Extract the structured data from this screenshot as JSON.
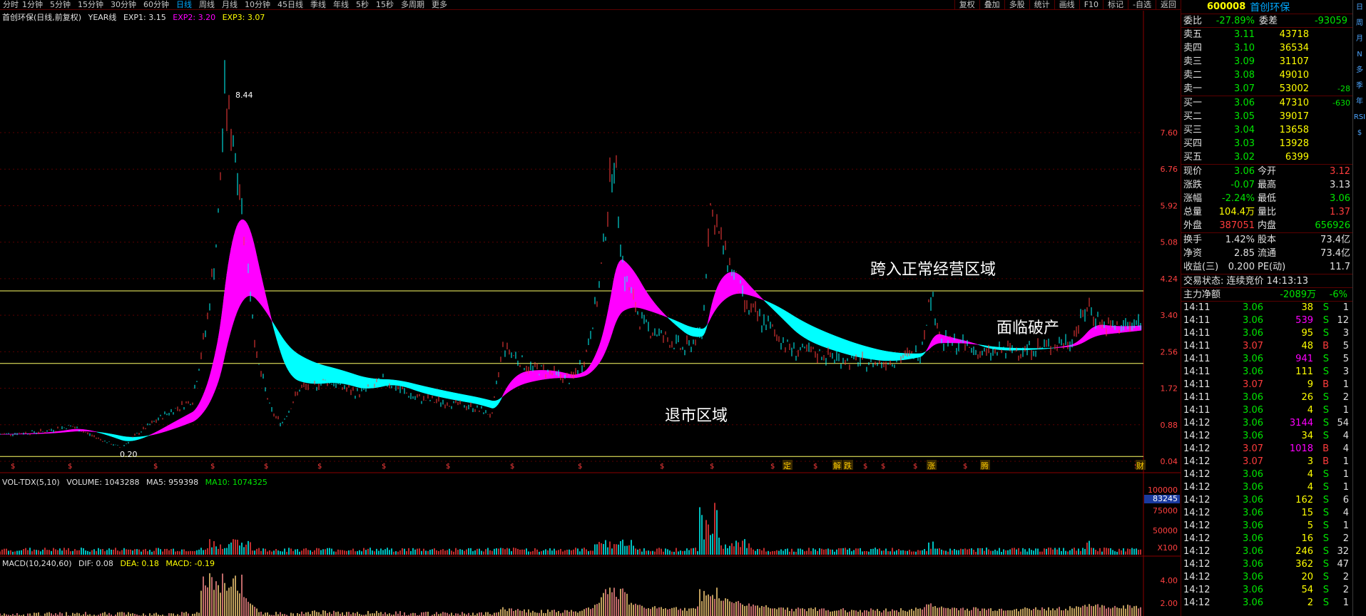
{
  "toolbar": {
    "info": "分时",
    "periods": [
      "1分钟",
      "5分钟",
      "15分钟",
      "30分钟",
      "60分钟",
      "日线",
      "周线",
      "月线",
      "10分钟",
      "45日线",
      "季线",
      "年线",
      "5秒",
      "15秒",
      "多周期",
      "更多"
    ],
    "active_period": "日线",
    "tools": [
      "复权",
      "叠加",
      "多股",
      "统计",
      "画线",
      "F10",
      "标记",
      "-自选",
      "返回"
    ]
  },
  "main_legend": {
    "title": "首创环保(日线,前复权)",
    "indicator": "YEAR线",
    "exp1": "EXP1: 3.15",
    "exp2": "EXP2: 3.20",
    "exp3": "EXP3: 3.07"
  },
  "vol_legend": {
    "name": "VOL-TDX(5,10)",
    "volume": "VOLUME: 1043288",
    "ma5": "MA5: 959398",
    "ma10": "MA10: 1074325"
  },
  "macd_legend": {
    "name": "MACD(10,240,60)",
    "dif": "DIF: 0.08",
    "dea": "DEA: 0.18",
    "macd": "MACD: -0.19"
  },
  "annotations": {
    "normal": "跨入正常经营区域",
    "bankrupt": "面临破产",
    "delist": "退市区域"
  },
  "price_labels": {
    "high": "8.44",
    "low": "0.20"
  },
  "price_axis": [
    "7.60",
    "6.76",
    "5.92",
    "5.08",
    "4.24",
    "3.40",
    "2.56",
    "1.72",
    "0.88",
    "0.04"
  ],
  "vol_axis": [
    "100000",
    "83245",
    "75000",
    "50000",
    "X100"
  ],
  "macd_axis": [
    "4.00",
    "2.00"
  ],
  "event_markers": [
    "定",
    "解",
    "跌",
    "涨",
    "腾",
    "财"
  ],
  "quote": {
    "code": "600008",
    "name": "首创环保",
    "weibi_label": "委比",
    "weibi": "-27.89%",
    "weicha_label": "委差",
    "weicha": "-93059",
    "asks": [
      {
        "label": "卖五",
        "price": "3.11",
        "vol": "43718",
        "chg": ""
      },
      {
        "label": "卖四",
        "price": "3.10",
        "vol": "36534",
        "chg": ""
      },
      {
        "label": "卖三",
        "price": "3.09",
        "vol": "31107",
        "chg": ""
      },
      {
        "label": "卖二",
        "price": "3.08",
        "vol": "49010",
        "chg": ""
      },
      {
        "label": "卖一",
        "price": "3.07",
        "vol": "53002",
        "chg": "-28"
      }
    ],
    "bids": [
      {
        "label": "买一",
        "price": "3.06",
        "vol": "47310",
        "chg": "-630"
      },
      {
        "label": "买二",
        "price": "3.05",
        "vol": "39017",
        "chg": ""
      },
      {
        "label": "买三",
        "price": "3.04",
        "vol": "13658",
        "chg": ""
      },
      {
        "label": "买四",
        "price": "3.03",
        "vol": "13928",
        "chg": ""
      },
      {
        "label": "买五",
        "price": "3.02",
        "vol": "6399",
        "chg": ""
      }
    ],
    "stats1": [
      {
        "l1": "现价",
        "v1": "3.06",
        "l2": "今开",
        "v2": "3.12"
      },
      {
        "l1": "涨跌",
        "v1": "-0.07",
        "l2": "最高",
        "v2": "3.13"
      },
      {
        "l1": "涨幅",
        "v1": "-2.24%",
        "l2": "最低",
        "v2": "3.06"
      },
      {
        "l1": "总量",
        "v1": "104.4万",
        "l2": "量比",
        "v2": "1.37"
      },
      {
        "l1": "外盘",
        "v1": "387051",
        "l2": "内盘",
        "v2": "656926"
      }
    ],
    "stats2": [
      {
        "l1": "换手",
        "v1": "1.42%",
        "l2": "股本",
        "v2": "73.4亿"
      },
      {
        "l1": "净资",
        "v1": "2.85",
        "l2": "流通",
        "v2": "73.4亿"
      },
      {
        "l1": "收益(三)",
        "v1": "0.200",
        "l2": "PE(动)",
        "v2": "11.7"
      }
    ],
    "trade_status": "交易状态: 连续竞价 14:13:13",
    "main_flow_label": "主力净额",
    "main_flow": "-2089万",
    "main_flow_pct": "-6%"
  },
  "ticks": [
    {
      "t": "14:11",
      "p": "3.06",
      "v": "38",
      "s": "S",
      "n": "1"
    },
    {
      "t": "14:11",
      "p": "3.06",
      "v": "539",
      "s": "S",
      "n": "12"
    },
    {
      "t": "14:11",
      "p": "3.06",
      "v": "95",
      "s": "S",
      "n": "3"
    },
    {
      "t": "14:11",
      "p": "3.07",
      "v": "48",
      "s": "B",
      "n": "5"
    },
    {
      "t": "14:11",
      "p": "3.06",
      "v": "941",
      "s": "S",
      "n": "5"
    },
    {
      "t": "14:11",
      "p": "3.06",
      "v": "111",
      "s": "S",
      "n": "3"
    },
    {
      "t": "14:11",
      "p": "3.07",
      "v": "9",
      "s": "B",
      "n": "1"
    },
    {
      "t": "14:11",
      "p": "3.06",
      "v": "26",
      "s": "S",
      "n": "2"
    },
    {
      "t": "14:11",
      "p": "3.06",
      "v": "4",
      "s": "S",
      "n": "1"
    },
    {
      "t": "14:12",
      "p": "3.06",
      "v": "3144",
      "s": "S",
      "n": "54"
    },
    {
      "t": "14:12",
      "p": "3.06",
      "v": "34",
      "s": "S",
      "n": "4"
    },
    {
      "t": "14:12",
      "p": "3.07",
      "v": "1018",
      "s": "B",
      "n": "4"
    },
    {
      "t": "14:12",
      "p": "3.07",
      "v": "3",
      "s": "B",
      "n": "1"
    },
    {
      "t": "14:12",
      "p": "3.06",
      "v": "4",
      "s": "S",
      "n": "1"
    },
    {
      "t": "14:12",
      "p": "3.06",
      "v": "4",
      "s": "S",
      "n": "1"
    },
    {
      "t": "14:12",
      "p": "3.06",
      "v": "162",
      "s": "S",
      "n": "6"
    },
    {
      "t": "14:12",
      "p": "3.06",
      "v": "15",
      "s": "S",
      "n": "4"
    },
    {
      "t": "14:12",
      "p": "3.06",
      "v": "5",
      "s": "S",
      "n": "1"
    },
    {
      "t": "14:12",
      "p": "3.06",
      "v": "16",
      "s": "S",
      "n": "2"
    },
    {
      "t": "14:12",
      "p": "3.06",
      "v": "246",
      "s": "S",
      "n": "32"
    },
    {
      "t": "14:12",
      "p": "3.06",
      "v": "362",
      "s": "S",
      "n": "47"
    },
    {
      "t": "14:12",
      "p": "3.06",
      "v": "20",
      "s": "S",
      "n": "2"
    },
    {
      "t": "14:12",
      "p": "3.06",
      "v": "54",
      "s": "S",
      "n": "2"
    },
    {
      "t": "14:12",
      "p": "3.06",
      "v": "2",
      "s": "S",
      "n": "1"
    }
  ],
  "side_strip": [
    "日",
    "周",
    "月",
    "N",
    "多",
    "季",
    "年",
    "RSI",
    "$"
  ]
}
